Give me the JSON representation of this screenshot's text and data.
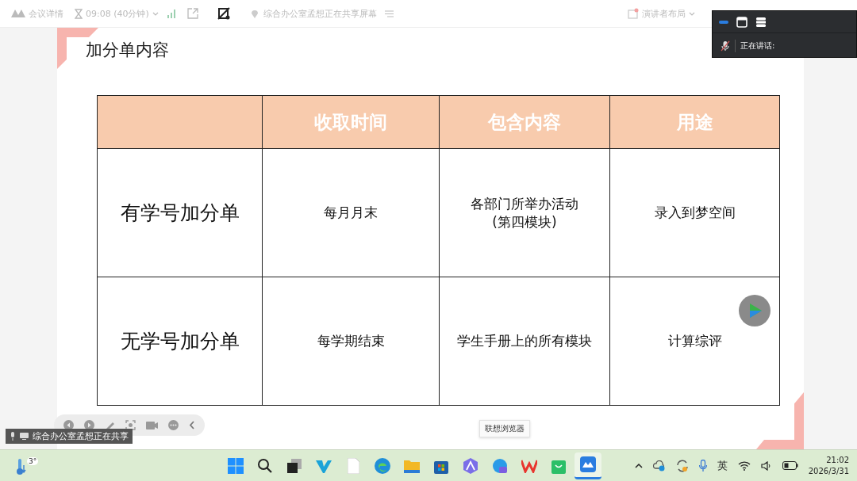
{
  "topbar": {
    "meeting_details": "会议详情",
    "time": "09:08 (40分钟)",
    "sharing": "综合办公室孟想正在共享屏幕",
    "layout": "演讲者布局"
  },
  "speaker_panel": {
    "label": "正在讲话:"
  },
  "slide": {
    "title": "加分单内容",
    "table": {
      "columns": [
        "收取时间",
        "包含内容",
        "用途"
      ],
      "rows": [
        {
          "label": "有学号加分单",
          "cells": [
            "每月月末",
            "各部门所举办活动\n(第四模块)",
            "录入到梦空间"
          ]
        },
        {
          "label": "无学号加分单",
          "cells": [
            "每学期结束",
            "学生手册上的所有模块",
            "计算综评"
          ]
        }
      ]
    }
  },
  "share_notice": "综合办公室孟想正在共享",
  "tooltip": "联想浏览器",
  "taskbar": {
    "weather": "3°",
    "apps": [
      {
        "kind": "start",
        "selected": false
      },
      {
        "kind": "search",
        "selected": false
      },
      {
        "kind": "taskview",
        "selected": false
      },
      {
        "kind": "v",
        "selected": false
      },
      {
        "kind": "file",
        "selected": false
      },
      {
        "kind": "edge",
        "selected": false
      },
      {
        "kind": "folder",
        "selected": false
      },
      {
        "kind": "store",
        "selected": false
      },
      {
        "kind": "hex",
        "selected": false
      },
      {
        "kind": "browser",
        "selected": false
      },
      {
        "kind": "wps",
        "selected": false
      },
      {
        "kind": "bag",
        "selected": false
      },
      {
        "kind": "meeting",
        "selected": true
      }
    ],
    "ime": "英",
    "time": "21:02",
    "date": "2026/3/31"
  }
}
